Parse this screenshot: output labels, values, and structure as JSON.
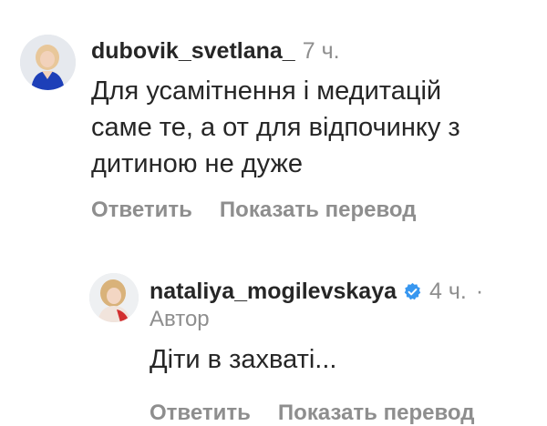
{
  "comments": [
    {
      "username": "dubovik_svetlana_",
      "time": "7 ч.",
      "text_lines": [
        "Для усамітнення і медитацій",
        "саме те, а от для відпочинку з",
        "дитиною не дуже"
      ],
      "actions": {
        "reply": "Ответить",
        "translate": "Показать перевод"
      }
    },
    {
      "username": "nataliya_mogilevskaya",
      "verified_icon": "verified-badge-icon",
      "time": "4 ч.",
      "separator": "·",
      "author_label": "Автор",
      "text": "Діти в захваті...",
      "actions": {
        "reply": "Ответить",
        "translate": "Показать перевод"
      }
    }
  ],
  "colors": {
    "text": "#262626",
    "secondary": "#8e8e8e",
    "verified": "#3897f0"
  }
}
